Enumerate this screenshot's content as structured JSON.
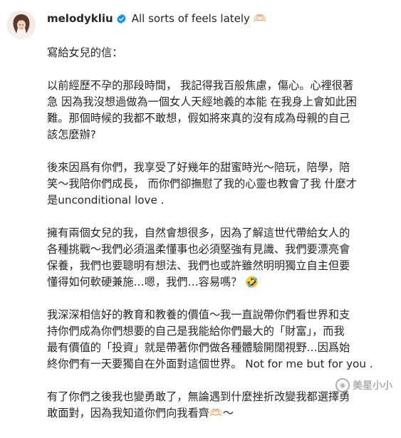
{
  "post": {
    "username": "melodykliu",
    "caption_first_line": "All sorts of feels lately 🫶🏻",
    "verified_icon": "verified-badge-icon",
    "avatar_icon": "profile-avatar",
    "paragraphs": [
      [
        "寫給女兒的信："
      ],
      [
        "以前經歷不孕的那段時間， 我記得我百般焦慮，傷心。心裡很著",
        "急 因為我沒想過做為一個女人天經地義的本能 在我身上會如此困",
        "難。那個時候的我都不敢想，假如將來真的沒有成為母親的自己",
        "該怎麼辦?"
      ],
      [
        "後來因爲有你們，我享受了好幾年的甜蜜時光～陪玩，陪學，陪",
        "笑～我陪你們成長， 而你們卻撫慰了我的心靈也教會了我 什麼才",
        "是unconditional love ."
      ],
      [
        "擁有兩個女兒的我，自然會想很多，因為了解這世代帶給女人的",
        "各種挑戰～我們必須溫柔懂事也必須堅強有見識、我們要漂亮會",
        "保養，我們也要聰明有想法、我們也或許雖然明明獨立自主但要",
        "懂得如何軟硬兼施…嗯，我們…容易嗎？ 🤣"
      ],
      [
        "我深深相信好的教育和教養的價值～我一直說帶你們看世界和支",
        "持你們成為你們想要的自己是我能給你們最大的「財富」，而我",
        "最有價值的「投資」就是帶著你們做各種體驗開闊視野…因爲始",
        "終你們有一天要獨自在外面對這個世界。 Not for me but for you ."
      ],
      [
        "有了你們之後我也變勇敢了，無論遇到什麼挫折改變我都選擇勇",
        "敢面對，因為我知道你們向我看齊🫶🏻～"
      ]
    ]
  },
  "watermark": {
    "label": "美星小小",
    "icon": "watermark-logo"
  }
}
